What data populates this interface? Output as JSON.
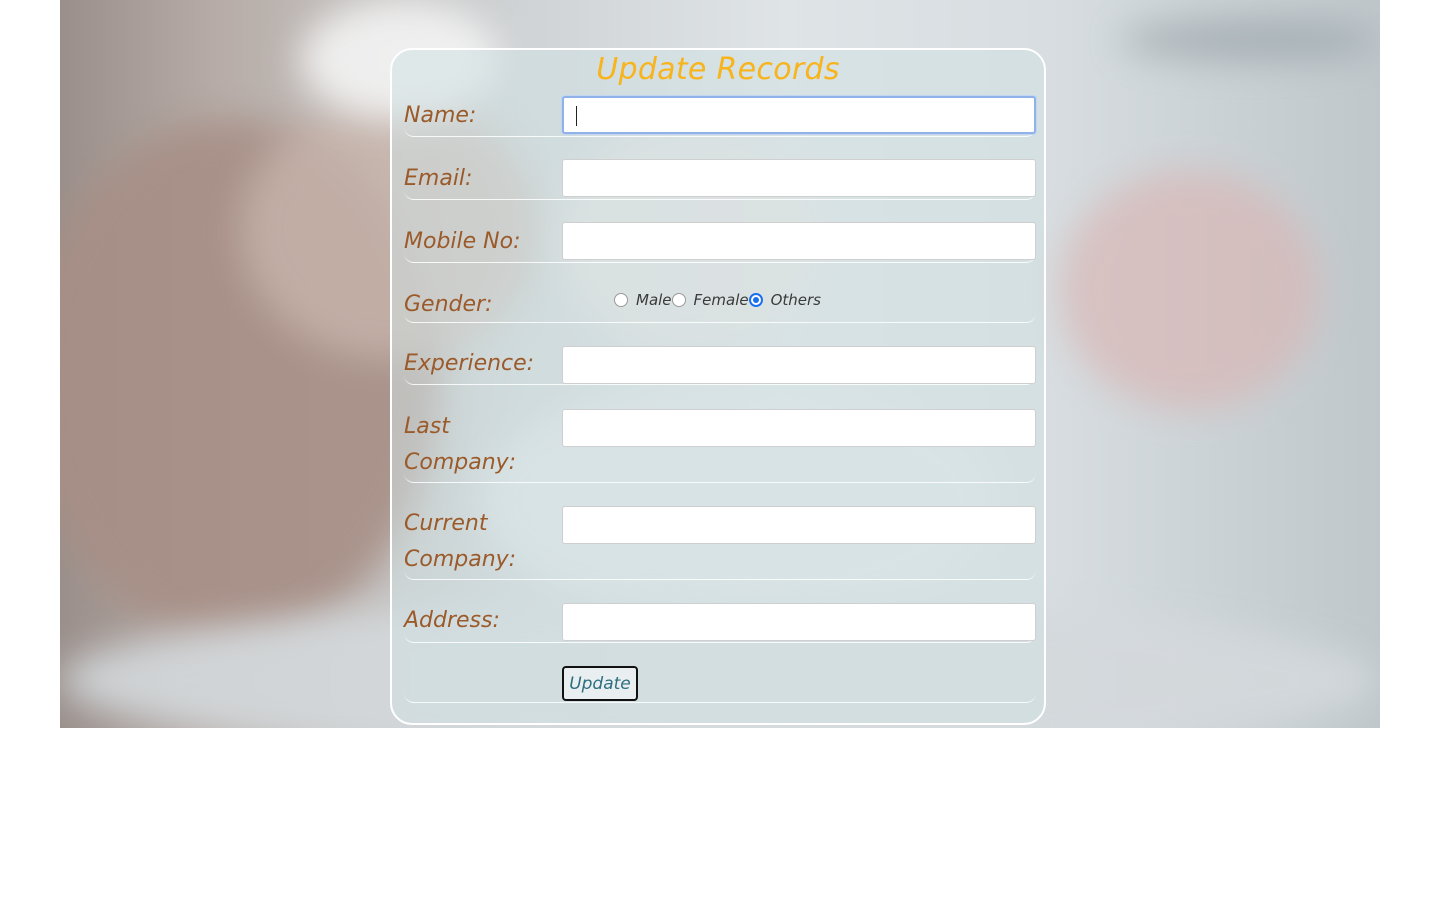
{
  "form": {
    "title": "Update Records",
    "fields": {
      "name": {
        "label": "Name:",
        "value": ""
      },
      "email": {
        "label": "Email:",
        "value": ""
      },
      "mobile": {
        "label": "Mobile No:",
        "value": ""
      },
      "gender": {
        "label": "Gender:",
        "options": [
          "Male",
          "Female",
          "Others"
        ],
        "selected": "Others"
      },
      "experience": {
        "label": "Experience:",
        "value": ""
      },
      "last_company": {
        "label_line1": "Last",
        "label_line2": "Company:",
        "value": ""
      },
      "current_company": {
        "label_line1": "Current",
        "label_line2": "Company:",
        "value": ""
      },
      "address": {
        "label": "Address:",
        "value": ""
      }
    },
    "submit_label": "Update"
  },
  "colors": {
    "title": "#f7b41c",
    "label": "#9b5a2a",
    "radio_accent": "#1a6ff0",
    "button_text": "#2d6f7f"
  }
}
